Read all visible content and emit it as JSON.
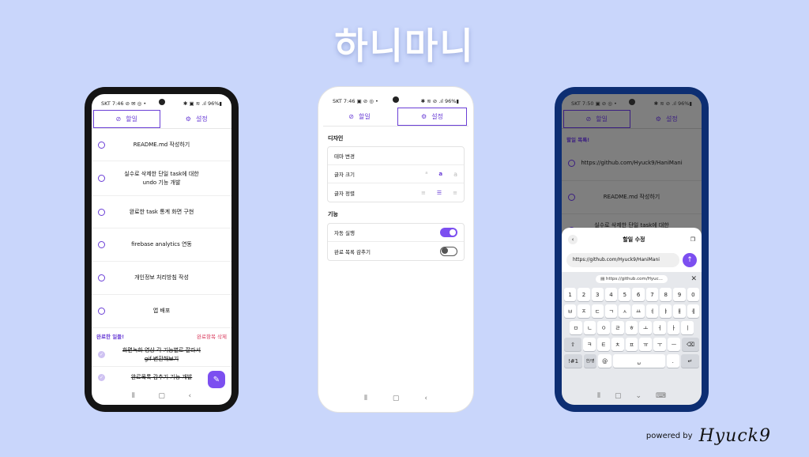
{
  "app_title": "하니마니",
  "colors": {
    "background": "#c9d6fb",
    "accent": "#6b3fd6",
    "danger": "#d9385b"
  },
  "phone1": {
    "status_time": "SKT 7:46 ⊘ ✉ ◎ •",
    "status_right": "✱ ▣ ≋ .ıl 96%▮",
    "tabs": [
      {
        "label": "할일",
        "icon": "check-circle-icon"
      },
      {
        "label": "설정",
        "icon": "gear-icon"
      }
    ],
    "todos": [
      "README.md 작성하기",
      "실수로 삭제한 단일 task에 대한 undo 기능 개발",
      "완료한 task 통계 화면 구현",
      "firebase analytics 연동",
      "개인정보 처리방침 작성",
      "앱 배포"
    ],
    "completed_header": "완료한 일들!",
    "completed_delete": "완료항목 삭제",
    "completed": [
      "화면녹화 영상 각 기능별로 잘라서 gif 변환해보기",
      "완료목록 감추기 기능 개발"
    ]
  },
  "phone2": {
    "status_time": "SKT 7:46 ▣ ⊘ ◎ •",
    "status_right": "✱ ≋ ⊘ .ıl 96%▮",
    "tabs": [
      {
        "label": "할일",
        "icon": "check-circle-icon"
      },
      {
        "label": "설정",
        "icon": "gear-icon"
      }
    ],
    "design_header": "디자인",
    "theme_label": "테마 변경",
    "font_size_label": "글자 크기",
    "font_size_options": [
      "a",
      "a",
      "a"
    ],
    "font_size_selected": 1,
    "align_label": "글자 정렬",
    "align_selected": 1,
    "feature_header": "기능",
    "autorun_label": "자동 실행",
    "autorun_on": true,
    "hide_done_label": "완료 목록 감추기",
    "hide_done_on": false
  },
  "phone3": {
    "status_time": "SKT 7:50 ▣ ⊘ ◎ •",
    "status_right": "✱ ≋ ⊘ .ıl 96%▮",
    "tabs": [
      {
        "label": "할일",
        "icon": "check-circle-icon"
      },
      {
        "label": "설정",
        "icon": "gear-icon"
      }
    ],
    "list_header": "할일 목록!",
    "todos": [
      "https://github.com/Hyuck9/HaniMani",
      "README.md 작성하기",
      "실수로 삭제한 단일 task에 대한 undo 기능 개발"
    ],
    "sheet_title": "할일 수정",
    "input_value": "https://github.com/Hyuck9/HaniMani",
    "clip_text": "https://github.com/Hyuc...",
    "keys_row1": [
      "1",
      "2",
      "3",
      "4",
      "5",
      "6",
      "7",
      "8",
      "9",
      "0"
    ],
    "keys_row2": [
      "ㅂ",
      "ㅈ",
      "ㄷ",
      "ㄱ",
      "ㅅ",
      "ㅛ",
      "ㅕ",
      "ㅑ",
      "ㅐ",
      "ㅔ"
    ],
    "keys_row3": [
      "ㅁ",
      "ㄴ",
      "ㅇ",
      "ㄹ",
      "ㅎ",
      "ㅗ",
      "ㅓ",
      "ㅏ",
      "ㅣ"
    ],
    "keys_row4": [
      "ㅋ",
      "ㅌ",
      "ㅊ",
      "ㅍ",
      "ㅠ",
      "ㅜ",
      "ㅡ"
    ],
    "key_symbols": "!#1",
    "key_lang": "한/영",
    "key_at": "@",
    "key_dot": "."
  },
  "footer": {
    "powered_by": "powered by",
    "signature": "Hyuck9"
  }
}
